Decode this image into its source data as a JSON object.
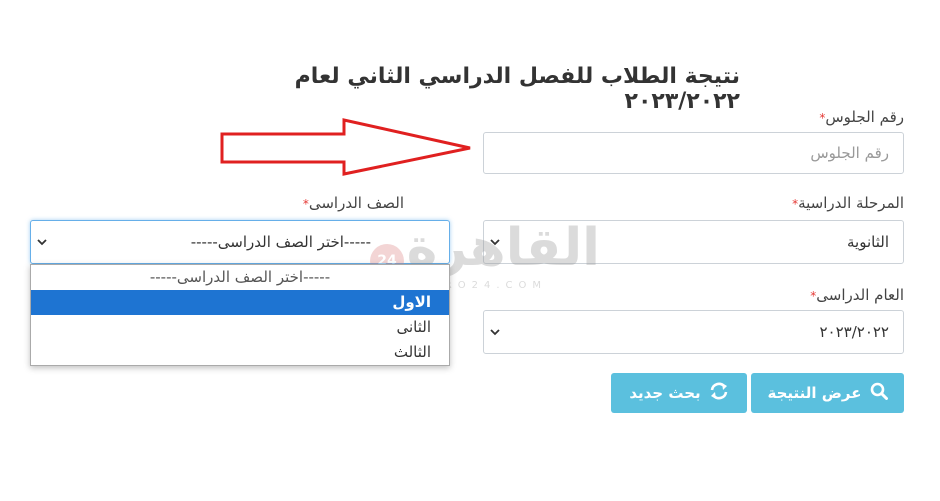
{
  "title": "نتيجة الطلاب للفصل الدراسي الثاني لعام ٢٠٢٣/٢٠٢٢",
  "seat_number": {
    "label": "رقم الجلوس",
    "required_mark": "*",
    "placeholder": "رقم الجلوس",
    "value": ""
  },
  "grade": {
    "label": "الصف الدراسى",
    "required_mark": "*",
    "selected": "-----اختر الصف الدراسى-----",
    "options": [
      "-----اختر الصف الدراسى-----",
      "الاول",
      "الثانى",
      "الثالث"
    ],
    "highlighted_index": 1
  },
  "stage": {
    "label": "المرحلة الدراسية",
    "required_mark": "*",
    "selected": "الثانوية"
  },
  "year": {
    "label": "العام الدراسى",
    "required_mark": "*",
    "selected": "٢٠٢٣/٢٠٢٢"
  },
  "buttons": {
    "show_result": "عرض النتيجة",
    "new_search": "بحث جديد"
  },
  "watermark": {
    "text": "القاهرة",
    "sub": "CAIRO24.COM",
    "badge": "24"
  },
  "colors": {
    "button_bg": "#5bc0de",
    "selected_option_bg": "#1e74d2",
    "arrow": "#e02020",
    "required": "#e53935"
  }
}
